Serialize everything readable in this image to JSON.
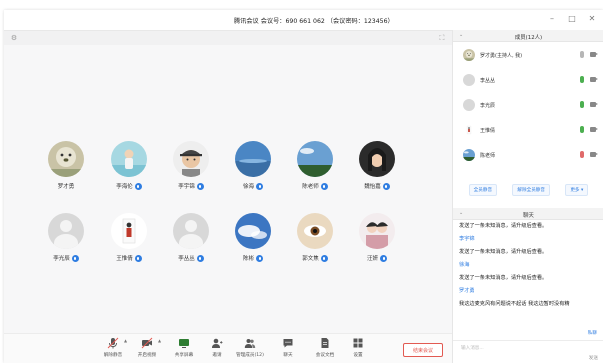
{
  "window": {
    "title": "腾讯会议 会议号：690 661 062 （会议密码：123456）",
    "minimize": "–",
    "restore": "□",
    "close": "✕"
  },
  "participants_grid": [
    {
      "name": "罗才勇",
      "mic": false,
      "avatar": "photo-dog"
    },
    {
      "name": "李海伦",
      "mic": true,
      "avatar": "photo-child"
    },
    {
      "name": "李宇锦",
      "mic": true,
      "avatar": "photo-cap"
    },
    {
      "name": "徐海",
      "mic": true,
      "avatar": "photo-sea"
    },
    {
      "name": "陈老师",
      "mic": true,
      "avatar": "photo-sky"
    },
    {
      "name": "魏怡嘉",
      "mic": true,
      "avatar": "photo-girl"
    },
    {
      "name": "李光辰",
      "mic": true,
      "avatar": "default"
    },
    {
      "name": "王惟倩",
      "mic": true,
      "avatar": "photo-figure"
    },
    {
      "name": "李丛丛",
      "mic": true,
      "avatar": "default"
    },
    {
      "name": "陈彬",
      "mic": true,
      "avatar": "photo-cloud"
    },
    {
      "name": "郭文焦",
      "mic": true,
      "avatar": "photo-eye"
    },
    {
      "name": "汪妍",
      "mic": true,
      "avatar": "photo-couple"
    }
  ],
  "toolbar": {
    "items": [
      {
        "label": "解除静音",
        "icon": "mic-icon"
      },
      {
        "label": "开启视频",
        "icon": "camera-icon"
      },
      {
        "label": "共享屏幕",
        "icon": "share-screen-icon"
      },
      {
        "label": "邀请",
        "icon": "invite-icon"
      },
      {
        "label": "管理成员(12)",
        "icon": "members-icon"
      },
      {
        "label": "聊天",
        "icon": "chat-icon"
      },
      {
        "label": "会议文档",
        "icon": "document-icon"
      },
      {
        "label": "设置",
        "icon": "settings-icon"
      }
    ],
    "end_label": "结束会议"
  },
  "members_panel": {
    "title": "成员(12人)",
    "members": [
      {
        "name": "罗才勇(主持人, 我)",
        "mic_color": "#b6b6b6",
        "avatar": "photo-dog"
      },
      {
        "name": "李丛丛",
        "mic_color": "#4caf50",
        "avatar": "default"
      },
      {
        "name": "李光辰",
        "mic_color": "#4caf50",
        "avatar": "default"
      },
      {
        "name": "王惟倩",
        "mic_color": "#4caf50",
        "avatar": "photo-figure"
      },
      {
        "name": "陈老师",
        "mic_color": "#e06a6a",
        "avatar": "photo-sky"
      }
    ],
    "actions": [
      "全员静音",
      "解除全员静音",
      "更多 ▾"
    ]
  },
  "chat_panel": {
    "title": "聊天",
    "messages": [
      {
        "type": "msg",
        "text": "发送了一条未知消息，请升级后查看。"
      },
      {
        "type": "name",
        "text": "李宇锦"
      },
      {
        "type": "msg",
        "text": "发送了一条未知消息，请升级后查看。"
      },
      {
        "type": "name",
        "text": "徐海"
      },
      {
        "type": "msg",
        "text": "发送了一条未知消息，请升级后查看。"
      },
      {
        "type": "name",
        "text": "罗才勇"
      },
      {
        "type": "msg",
        "text": "我这边麦克风有问题说不起话 我这边暂时没有精"
      }
    ],
    "private_chat": "私聊",
    "input_placeholder": "输入消息...",
    "send_label": "发送"
  },
  "colors": {
    "accent": "#2f7de1",
    "danger": "#e25a52"
  }
}
